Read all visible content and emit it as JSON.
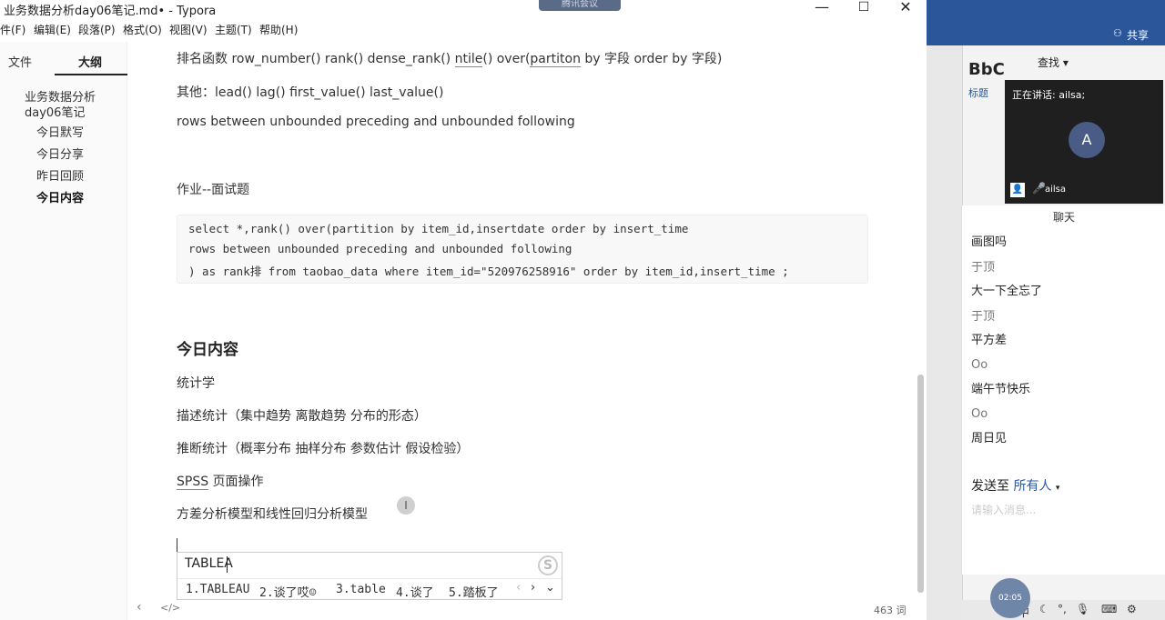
{
  "window": {
    "title": "业务数据分析day06笔记.md• - Typora",
    "min": "—",
    "max": "☐",
    "close": "✕",
    "meeting_float": "腾讯会议"
  },
  "menu": [
    "件(F)",
    "编辑(E)",
    "段落(P)",
    "格式(O)",
    "视图(V)",
    "主题(T)",
    "帮助(H)"
  ],
  "sidebar": {
    "tab_files": "文件",
    "tab_outline": "大纲",
    "toc": {
      "root": "业务数据分析day06笔记",
      "items": [
        "今日默写",
        "今日分享",
        "昨日回顾",
        "今日内容"
      ],
      "active": "今日内容"
    }
  },
  "editor": {
    "line_rank": {
      "pre": "排名函数 row_number() rank() dense_rank() ",
      "ntile": "ntile",
      "mid": "() over(",
      "partiton": "partiton",
      "post": " by 字段 order by 字段)"
    },
    "line_other": "其他：lead() lag() first_value() last_value()",
    "line_rows": "rows between unbounded preceding and unbounded following",
    "homework": "作业--面试题",
    "code": [
      "select *,rank() over(partition by item_id,insertdate order by insert_time",
      "rows between unbounded preceding and unbounded following",
      ") as rank排 from taobao_data where item_id=\"520976258916\" order by item_id,insert_time ;"
    ],
    "heading_today": "今日内容",
    "items": {
      "stats": "统计学",
      "descriptive": "描述统计（集中趋势 离散趋势 分布的形态）",
      "inferential": "推断统计（概率分布 抽样分布 参数估计 假设检验）",
      "spss_word": "SPSS",
      "spss_rest": " 页面操作",
      "anova": "方差分析模型和线性回归分析模型"
    }
  },
  "ime": {
    "input": "TABLEA",
    "candidates": [
      "1.TABLEAU",
      "2.谈了哎☺",
      "3.table",
      "4.谈了",
      "5.踏板了"
    ],
    "prev": "‹",
    "next": "›",
    "more": "⌄",
    "logo": "S"
  },
  "statusbar": {
    "back": "‹",
    "source": "</>",
    "words": "463 词"
  },
  "word_bg": {
    "share": "共享",
    "style": "BbC",
    "style_sub": "标题",
    "find": "查找 ▾"
  },
  "meeting": {
    "speaking_label": "正在讲话: ailsa;",
    "avatar_letter": "A",
    "participant_name": "ailsa",
    "mic_icon": "🎤"
  },
  "chat": {
    "title": "聊天",
    "messages": [
      {
        "sender": "",
        "text": "画图吗"
      },
      {
        "sender": "于顶",
        "text": "大一下全忘了"
      },
      {
        "sender": "于顶",
        "text": "平方差"
      },
      {
        "sender": "Oo",
        "text": "端午节快乐"
      },
      {
        "sender": "Oo",
        "text": "周日见"
      }
    ],
    "send_to_label": "发送至",
    "send_to_target": "所有人",
    "input_placeholder": "请输入消息..."
  },
  "taskbar": {
    "time_badge": "02:05",
    "ime": "中",
    "moon": "☾",
    "dot": "°,",
    "mic": "🎙",
    "keyboard": "⌨",
    "settings": "⚙"
  }
}
